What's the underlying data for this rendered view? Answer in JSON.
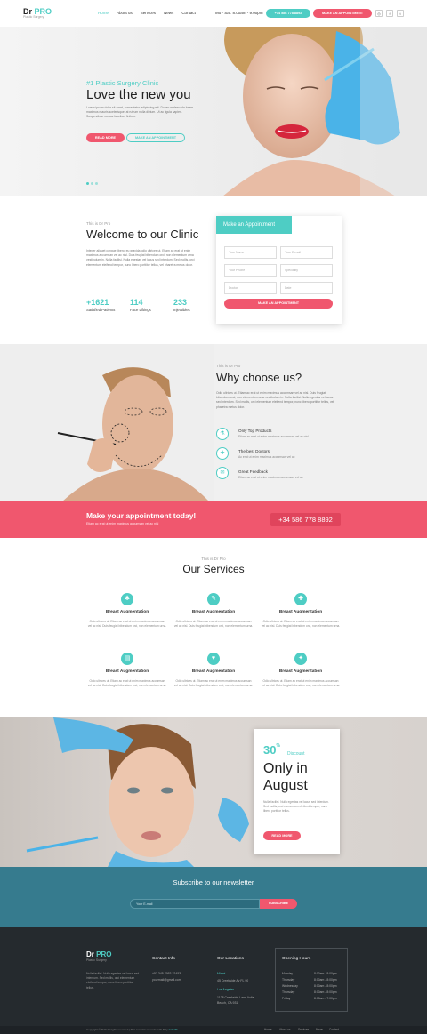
{
  "brand": {
    "name_a": "Dr",
    "name_b": "PRO",
    "tagline": "Plastic Surgery"
  },
  "nav": {
    "items": [
      "Home",
      "About us",
      "Services",
      "News",
      "Contact"
    ],
    "active": "Home"
  },
  "header": {
    "hours": "Mo - Sat: 8:00am - 9:00pm",
    "phone": "+34 586 778 8892",
    "appointment": "MAKE AN APPOINTMENT"
  },
  "hero": {
    "subtitle": "#1 Plastic Surgery Clinic",
    "title": "Love the new you",
    "text": "Lorem ipsum dolor sit amet, consectetur adipiscing elit. Donec malesuada lorem maximus mauris scelerisque, at rutrum nulla dictum. Ut ac ligula sapien. Suspendisse cursus faucibus finibus.",
    "read_more": "READ MORE",
    "appointment": "MAKE AN APPOINTMENT"
  },
  "welcome": {
    "small": "This is Dr Pro",
    "title": "Welcome to our Clinic",
    "text": "Integer aliquet congue libero, eu gravida odio ultrices ut. Etiam ac erat ut enim maximus accumsan vel ac nisl. Duis feugiat bibendum orci, non elementum urna vestibulum in. Nulla facilisi. Nulla egestas vel lacus sed interdum. Sed mollis, orci elementum eleifend tempor, nunc libero porttitor tellus, vel pharetra metus dolor.",
    "stats": [
      {
        "num": "+1621",
        "label": "Satisfied Patients"
      },
      {
        "num": "114",
        "label": "Face Liftings"
      },
      {
        "num": "233",
        "label": "Injectibles"
      }
    ]
  },
  "form": {
    "title": "Make an Appointment",
    "fields": [
      "Your Name",
      "Your E-mail",
      "Your Phone",
      "Speciality",
      "Doctor",
      "Date"
    ],
    "submit": "MAKE AN APPOINTMENT"
  },
  "why": {
    "small": "This is Dr Pro",
    "title": "Why choose us?",
    "text": "Odio ultrices ut. Etiam ac erat ut enim maximus accumsan vel ac nisl. Duis feugiat bibendum orci, non elementum urna vestibulum in. Nulla facilisi. Nulla egestas vel lacus sed interdum. Sed mollis, orci elementum eleifend tempor, nunc libero porttitor tellus, vel pharetra metus dolor.",
    "features": [
      {
        "title": "Only Top Products",
        "text": "Etiam ac erat ut enim maximus accumsan vel ac nisl.",
        "icon": "flask-icon"
      },
      {
        "title": "The best Doctors",
        "text": "Ac erat ut enim maximus accumsan vel ac",
        "icon": "doctor-icon"
      },
      {
        "title": "Great Feedback",
        "text": "Etiam ac erat ut enim maximus accumsan vel ac",
        "icon": "chat-icon"
      }
    ]
  },
  "cta": {
    "title": "Make your appointment today!",
    "text": "Etiam ac erat ut enim maximus accumsan vel ac nisl",
    "phone": "+34 586 778 8892"
  },
  "services": {
    "small": "This is Dr Pro",
    "title": "Our Services",
    "items": [
      {
        "title": "Breast Augmentation",
        "text": "Odio ultrices ut. Etiam ac erat ut enim maximus accumsan vel ac nisl. Duis feugiat bibendum orci, non elementum urna."
      },
      {
        "title": "Breast Augmentation",
        "text": "Odio ultrices ut. Etiam ac erat ut enim maximus accumsan vel ac nisl. Duis feugiat bibendum orci, non elementum urna."
      },
      {
        "title": "Breast Augmentation",
        "text": "Odio ultrices ut. Etiam ac erat ut enim maximus accumsan vel ac nisl. Duis feugiat bibendum orci, non elementum urna."
      },
      {
        "title": "Breast Augmentation",
        "text": "Odio ultrices ut. Etiam ac erat ut enim maximus accumsan vel ac nisl. Duis feugiat bibendum orci, non elementum urna."
      },
      {
        "title": "Breast Augmentation",
        "text": "Odio ultrices ut. Etiam ac erat ut enim maximus accumsan vel ac nisl. Duis feugiat bibendum orci, non elementum urna."
      },
      {
        "title": "Breast Augmentation",
        "text": "Odio ultrices ut. Etiam ac erat ut enim maximus accumsan vel ac nisl. Duis feugiat bibendum orci, non elementum urna."
      }
    ]
  },
  "promo": {
    "pct": "30",
    "pct_sign": "%",
    "discount": "Discount",
    "title": "Only in August",
    "text": "Nulla facilisi. Nulla egestas vel lacus sed interdum. Sed mollis, orci elementum eleifend tempor, nunc libero porttitor tellus.",
    "button": "READ MORE"
  },
  "newsletter": {
    "title": "Subscribe to our newsletter",
    "placeholder": "Your E-mail",
    "button": "SUBSCRIBE"
  },
  "footer": {
    "text": "Nulla facilisi. Nulla egestas vel lacus sed interdum. Sed mollis, orci elementum eleifend tempor, nunc libero porttitor tellus.",
    "contact_head": "Contact Info",
    "contact": [
      "+53 345 7953 32453",
      "yourmail@gmail.com"
    ],
    "loc_head": "Our Locations",
    "loc1_name": "Miami",
    "loc1_addr": "45 Creekside Av FL 90",
    "loc2_name": "Los Angeles",
    "loc2_addr_a": "1128 Creekside Lane Avila",
    "loc2_addr_b": "Beach, CA 931",
    "oh_head": "Opening Hours",
    "hours": [
      {
        "day": "Monday",
        "time": "8:00am - 8:00pm"
      },
      {
        "day": "Thursday",
        "time": "8:00am - 8:00pm"
      },
      {
        "day": "Wednesday",
        "time": "8:00am - 8:00pm"
      },
      {
        "day": "Thursday",
        "time": "8:00am - 8:00pm"
      },
      {
        "day": "Friday",
        "time": "8:00am - 7:00pm"
      }
    ],
    "copyright": "Copyright ©2020 All rights reserved | This template is made with ♥ by",
    "copyright_link": "Colorlib",
    "bottom_nav": [
      "Home",
      "About us",
      "Services",
      "News",
      "Contact"
    ]
  },
  "colors": {
    "accent": "#4ecdc4",
    "brand_pink": "#f0576e",
    "newsletter": "#367b8e",
    "footer": "#252a2e"
  }
}
